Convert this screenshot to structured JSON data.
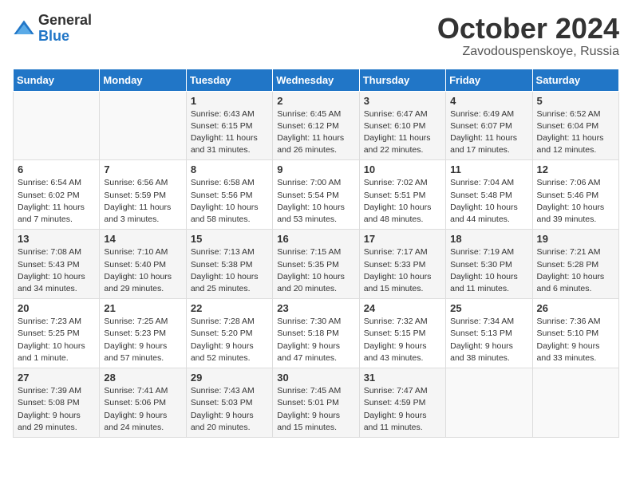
{
  "logo": {
    "general": "General",
    "blue": "Blue"
  },
  "title": "October 2024",
  "subtitle": "Zavodouspenskoye, Russia",
  "days_header": [
    "Sunday",
    "Monday",
    "Tuesday",
    "Wednesday",
    "Thursday",
    "Friday",
    "Saturday"
  ],
  "weeks": [
    [
      {
        "num": "",
        "info": ""
      },
      {
        "num": "",
        "info": ""
      },
      {
        "num": "1",
        "info": "Sunrise: 6:43 AM\nSunset: 6:15 PM\nDaylight: 11 hours\nand 31 minutes."
      },
      {
        "num": "2",
        "info": "Sunrise: 6:45 AM\nSunset: 6:12 PM\nDaylight: 11 hours\nand 26 minutes."
      },
      {
        "num": "3",
        "info": "Sunrise: 6:47 AM\nSunset: 6:10 PM\nDaylight: 11 hours\nand 22 minutes."
      },
      {
        "num": "4",
        "info": "Sunrise: 6:49 AM\nSunset: 6:07 PM\nDaylight: 11 hours\nand 17 minutes."
      },
      {
        "num": "5",
        "info": "Sunrise: 6:52 AM\nSunset: 6:04 PM\nDaylight: 11 hours\nand 12 minutes."
      }
    ],
    [
      {
        "num": "6",
        "info": "Sunrise: 6:54 AM\nSunset: 6:02 PM\nDaylight: 11 hours\nand 7 minutes."
      },
      {
        "num": "7",
        "info": "Sunrise: 6:56 AM\nSunset: 5:59 PM\nDaylight: 11 hours\nand 3 minutes."
      },
      {
        "num": "8",
        "info": "Sunrise: 6:58 AM\nSunset: 5:56 PM\nDaylight: 10 hours\nand 58 minutes."
      },
      {
        "num": "9",
        "info": "Sunrise: 7:00 AM\nSunset: 5:54 PM\nDaylight: 10 hours\nand 53 minutes."
      },
      {
        "num": "10",
        "info": "Sunrise: 7:02 AM\nSunset: 5:51 PM\nDaylight: 10 hours\nand 48 minutes."
      },
      {
        "num": "11",
        "info": "Sunrise: 7:04 AM\nSunset: 5:48 PM\nDaylight: 10 hours\nand 44 minutes."
      },
      {
        "num": "12",
        "info": "Sunrise: 7:06 AM\nSunset: 5:46 PM\nDaylight: 10 hours\nand 39 minutes."
      }
    ],
    [
      {
        "num": "13",
        "info": "Sunrise: 7:08 AM\nSunset: 5:43 PM\nDaylight: 10 hours\nand 34 minutes."
      },
      {
        "num": "14",
        "info": "Sunrise: 7:10 AM\nSunset: 5:40 PM\nDaylight: 10 hours\nand 29 minutes."
      },
      {
        "num": "15",
        "info": "Sunrise: 7:13 AM\nSunset: 5:38 PM\nDaylight: 10 hours\nand 25 minutes."
      },
      {
        "num": "16",
        "info": "Sunrise: 7:15 AM\nSunset: 5:35 PM\nDaylight: 10 hours\nand 20 minutes."
      },
      {
        "num": "17",
        "info": "Sunrise: 7:17 AM\nSunset: 5:33 PM\nDaylight: 10 hours\nand 15 minutes."
      },
      {
        "num": "18",
        "info": "Sunrise: 7:19 AM\nSunset: 5:30 PM\nDaylight: 10 hours\nand 11 minutes."
      },
      {
        "num": "19",
        "info": "Sunrise: 7:21 AM\nSunset: 5:28 PM\nDaylight: 10 hours\nand 6 minutes."
      }
    ],
    [
      {
        "num": "20",
        "info": "Sunrise: 7:23 AM\nSunset: 5:25 PM\nDaylight: 10 hours\nand 1 minute."
      },
      {
        "num": "21",
        "info": "Sunrise: 7:25 AM\nSunset: 5:23 PM\nDaylight: 9 hours\nand 57 minutes."
      },
      {
        "num": "22",
        "info": "Sunrise: 7:28 AM\nSunset: 5:20 PM\nDaylight: 9 hours\nand 52 minutes."
      },
      {
        "num": "23",
        "info": "Sunrise: 7:30 AM\nSunset: 5:18 PM\nDaylight: 9 hours\nand 47 minutes."
      },
      {
        "num": "24",
        "info": "Sunrise: 7:32 AM\nSunset: 5:15 PM\nDaylight: 9 hours\nand 43 minutes."
      },
      {
        "num": "25",
        "info": "Sunrise: 7:34 AM\nSunset: 5:13 PM\nDaylight: 9 hours\nand 38 minutes."
      },
      {
        "num": "26",
        "info": "Sunrise: 7:36 AM\nSunset: 5:10 PM\nDaylight: 9 hours\nand 33 minutes."
      }
    ],
    [
      {
        "num": "27",
        "info": "Sunrise: 7:39 AM\nSunset: 5:08 PM\nDaylight: 9 hours\nand 29 minutes."
      },
      {
        "num": "28",
        "info": "Sunrise: 7:41 AM\nSunset: 5:06 PM\nDaylight: 9 hours\nand 24 minutes."
      },
      {
        "num": "29",
        "info": "Sunrise: 7:43 AM\nSunset: 5:03 PM\nDaylight: 9 hours\nand 20 minutes."
      },
      {
        "num": "30",
        "info": "Sunrise: 7:45 AM\nSunset: 5:01 PM\nDaylight: 9 hours\nand 15 minutes."
      },
      {
        "num": "31",
        "info": "Sunrise: 7:47 AM\nSunset: 4:59 PM\nDaylight: 9 hours\nand 11 minutes."
      },
      {
        "num": "",
        "info": ""
      },
      {
        "num": "",
        "info": ""
      }
    ]
  ]
}
